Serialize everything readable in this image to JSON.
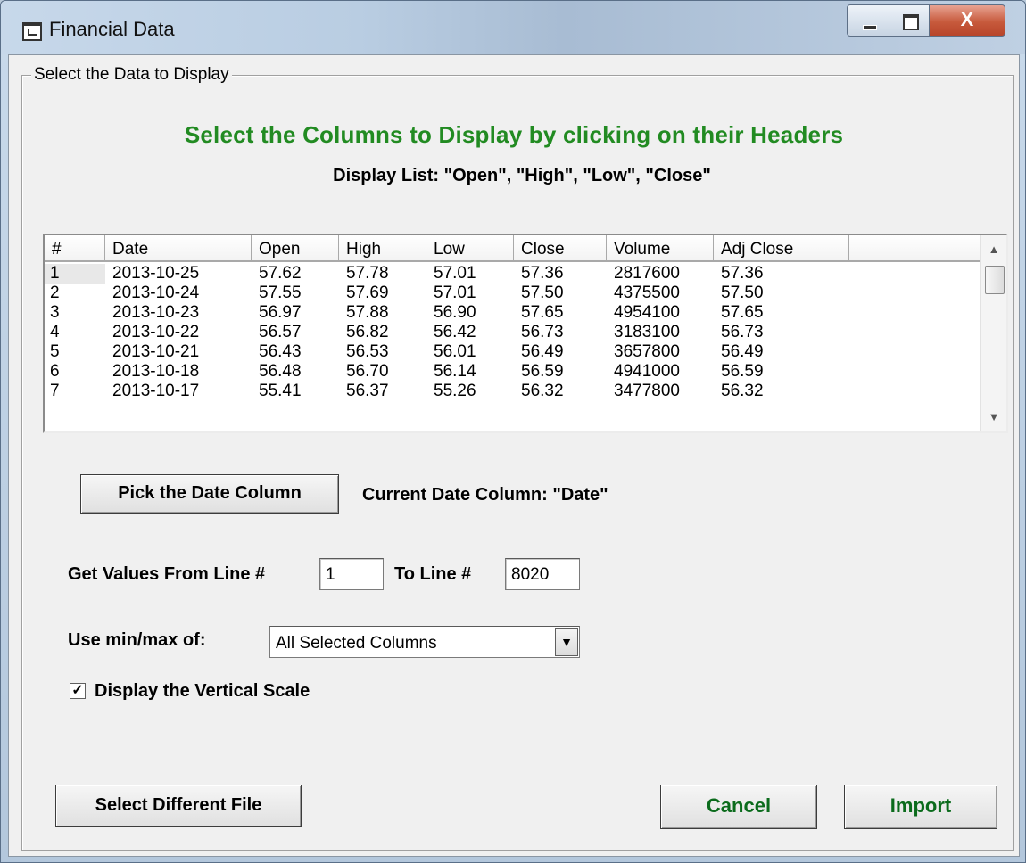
{
  "window": {
    "title": "Financial Data",
    "minimize_glyph": "",
    "maximize_glyph": "",
    "close_glyph": "X"
  },
  "groupbox": {
    "label": "Select the Data to Display"
  },
  "instructions": {
    "heading": "Select the Columns to Display by clicking on their Headers",
    "display_list": "Display List: \"Open\", \"High\", \"Low\", \"Close\"",
    "heading_color": "#228b22"
  },
  "table": {
    "columns": [
      "#",
      "Date",
      "Open",
      "High",
      "Low",
      "Close",
      "Volume",
      "Adj Close",
      ""
    ],
    "rows": [
      [
        "1",
        "2013-10-25",
        "57.62",
        "57.78",
        "57.01",
        "57.36",
        "2817600",
        "57.36"
      ],
      [
        "2",
        "2013-10-24",
        "57.55",
        "57.69",
        "57.01",
        "57.50",
        "4375500",
        "57.50"
      ],
      [
        "3",
        "2013-10-23",
        "56.97",
        "57.88",
        "56.90",
        "57.65",
        "4954100",
        "57.65"
      ],
      [
        "4",
        "2013-10-22",
        "56.57",
        "56.82",
        "56.42",
        "56.73",
        "3183100",
        "56.73"
      ],
      [
        "5",
        "2013-10-21",
        "56.43",
        "56.53",
        "56.01",
        "56.49",
        "3657800",
        "56.49"
      ],
      [
        "6",
        "2013-10-18",
        "56.48",
        "56.70",
        "56.14",
        "56.59",
        "4941000",
        "56.59"
      ],
      [
        "7",
        "2013-10-17",
        "55.41",
        "56.37",
        "55.26",
        "56.32",
        "3477800",
        "56.32"
      ]
    ],
    "scroll_up_glyph": "▲",
    "scroll_down_glyph": "▼"
  },
  "date_column": {
    "button_label": "Pick the Date Column",
    "current_label": "Current Date Column: \"Date\""
  },
  "line_range": {
    "from_label": "Get Values From Line #",
    "from_value": "1",
    "to_label": "To Line #",
    "to_value": "8020"
  },
  "minmax": {
    "label": "Use min/max of:",
    "selected": "All Selected Columns",
    "dropdown_glyph": "▼"
  },
  "vertical_scale": {
    "checked": true,
    "check_glyph": "✓",
    "label": "Display the Vertical Scale"
  },
  "buttons": {
    "select_file": "Select Different File",
    "cancel": "Cancel",
    "import": "Import",
    "cancel_import_color": "#0b6b1c"
  }
}
